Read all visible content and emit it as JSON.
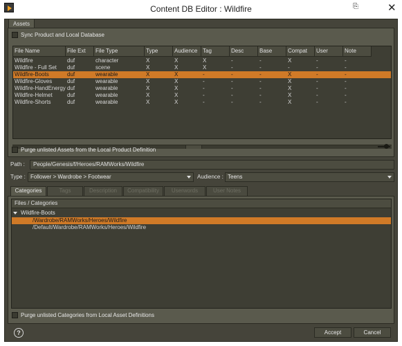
{
  "window": {
    "title": "Content DB Editor : Wildfire",
    "close_label": "✕",
    "help_corner": "⎘"
  },
  "assets_tab": {
    "label": "Assets"
  },
  "sync_checkbox": {
    "label": "Sync Product and Local Database",
    "checked": false
  },
  "table": {
    "columns": [
      "File Name",
      "File Ext",
      "File Type",
      "Type",
      "Audience",
      "Tag",
      "Desc",
      "Base",
      "Compat",
      "User",
      "Note"
    ],
    "rows": [
      [
        "Wildfire",
        "duf",
        "character",
        "X",
        "X",
        "X",
        "-",
        "-",
        "X",
        "-",
        "-"
      ],
      [
        "Wildfire - Full Set",
        "duf",
        "scene",
        "X",
        "X",
        "X",
        "-",
        "-",
        "-",
        "-",
        "-"
      ],
      [
        "Wildfire-Boots",
        "duf",
        "wearable",
        "X",
        "X",
        "-",
        "-",
        "-",
        "X",
        "-",
        "-"
      ],
      [
        "Wildfire-Gloves",
        "duf",
        "wearable",
        "X",
        "X",
        "-",
        "-",
        "-",
        "X",
        "-",
        "-"
      ],
      [
        "Wildfire-HandEnergy",
        "duf",
        "wearable",
        "X",
        "X",
        "-",
        "-",
        "-",
        "X",
        "-",
        "-"
      ],
      [
        "Wildfire-Helmet",
        "duf",
        "wearable",
        "X",
        "X",
        "-",
        "-",
        "-",
        "X",
        "-",
        "-"
      ],
      [
        "Wildfire-Shorts",
        "duf",
        "wearable",
        "X",
        "X",
        "-",
        "-",
        "-",
        "X",
        "-",
        "-"
      ]
    ],
    "selected_row": 2
  },
  "purge_assets": {
    "label": "Purge unlisted Assets from the Local Product Definition"
  },
  "path": {
    "label": "Path :",
    "value": "People/Genesis/f/Heroes/RAMWorks/Wildfire"
  },
  "type": {
    "label": "Type :",
    "value": "Follower > Wardrobe > Footwear"
  },
  "audience": {
    "label": "Audience :",
    "value": "Teens"
  },
  "detail_tabs": [
    {
      "label": "Categories",
      "active": true
    },
    {
      "label": "Tags",
      "active": false
    },
    {
      "label": "Description",
      "active": false
    },
    {
      "label": "Compatibility",
      "active": false
    },
    {
      "label": "Userwords",
      "active": false
    },
    {
      "label": "User Notes",
      "active": false
    }
  ],
  "categories": {
    "header": "Files / Categories",
    "root": "Wildfire-Boots",
    "items": [
      {
        "label": "/Wardrobe/RAMWorks/Heroes/Wildfire",
        "selected": true
      },
      {
        "label": "/Default/Wardrobe/RAMWorks/Heroes/Wildfire",
        "selected": false
      }
    ]
  },
  "purge_categories": {
    "label": "Purge unlisted Categories from Local Asset Definitions"
  },
  "buttons": {
    "help": "?",
    "accept": "Accept",
    "cancel": "Cancel"
  },
  "colors": {
    "selection": "#d07a27",
    "panel": "#5a5a4d",
    "background": "#45443a"
  }
}
